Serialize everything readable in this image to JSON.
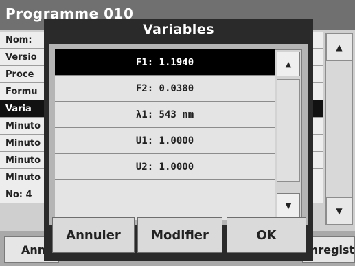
{
  "background_window": {
    "title": "Programme 010",
    "rows": [
      {
        "label": "Nom:"
      },
      {
        "label": "Versio"
      },
      {
        "label": "Proce"
      },
      {
        "label": "Formu"
      },
      {
        "label": "Varia",
        "selected": true
      },
      {
        "label": "Minuto"
      },
      {
        "label": "Minuto"
      },
      {
        "label": "Minuto"
      },
      {
        "label": "Minuto"
      },
      {
        "label": "No: 4"
      }
    ],
    "bottom_buttons": {
      "left": "Annuler",
      "right": "Enregistrer"
    }
  },
  "dialog": {
    "title": "Variables",
    "items": [
      {
        "label": "F1: 1.1940",
        "selected": true
      },
      {
        "label": "F2: 0.0380"
      },
      {
        "label": "λ1: 543 nm"
      },
      {
        "label": "U1: 1.0000"
      },
      {
        "label": "U2: 1.0000"
      },
      {
        "label": ""
      }
    ],
    "scroll_up_icon": "triangle-up-icon",
    "scroll_down_icon": "triangle-down-icon",
    "buttons": {
      "cancel": "Annuler",
      "modify": "Modifier",
      "ok": "OK"
    }
  }
}
